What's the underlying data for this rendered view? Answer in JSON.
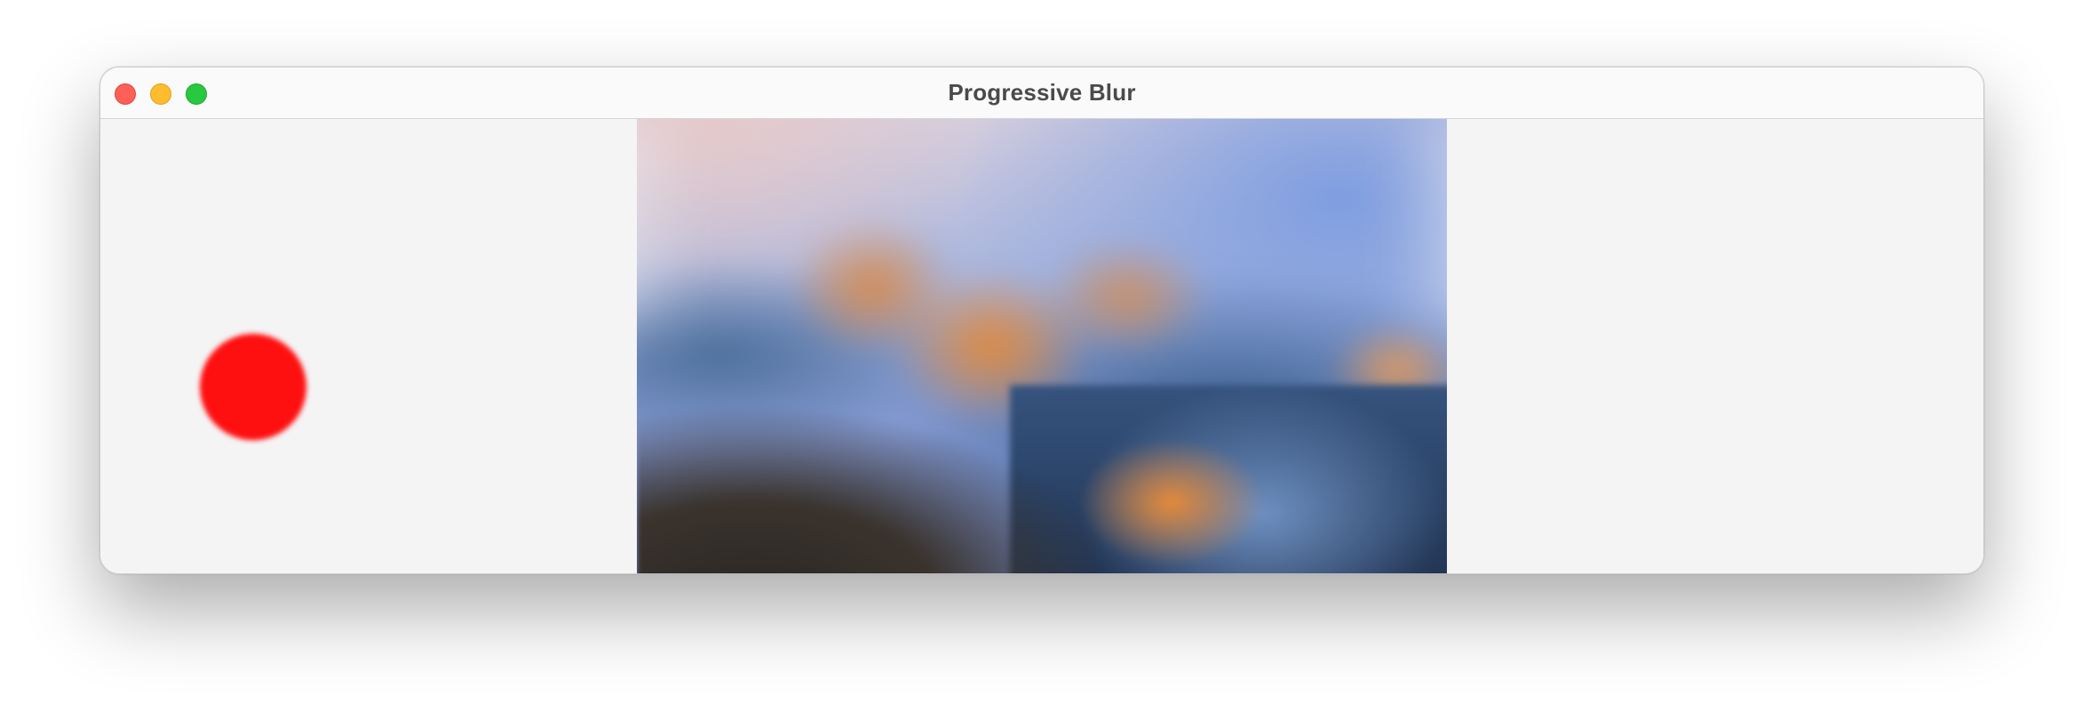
{
  "window": {
    "title": "Progressive Blur"
  },
  "traffic_lights": {
    "close": "close-icon",
    "minimize": "minimize-icon",
    "maximize": "zoom-icon"
  },
  "content": {
    "image": "mountain-landscape-blurred",
    "circle_color": "#ff1010"
  },
  "colors": {
    "background": "#f4f4f5",
    "titlebar": "#fafafa",
    "close": "#fe5f57",
    "minimize": "#febc2e",
    "maximize": "#28c840"
  }
}
